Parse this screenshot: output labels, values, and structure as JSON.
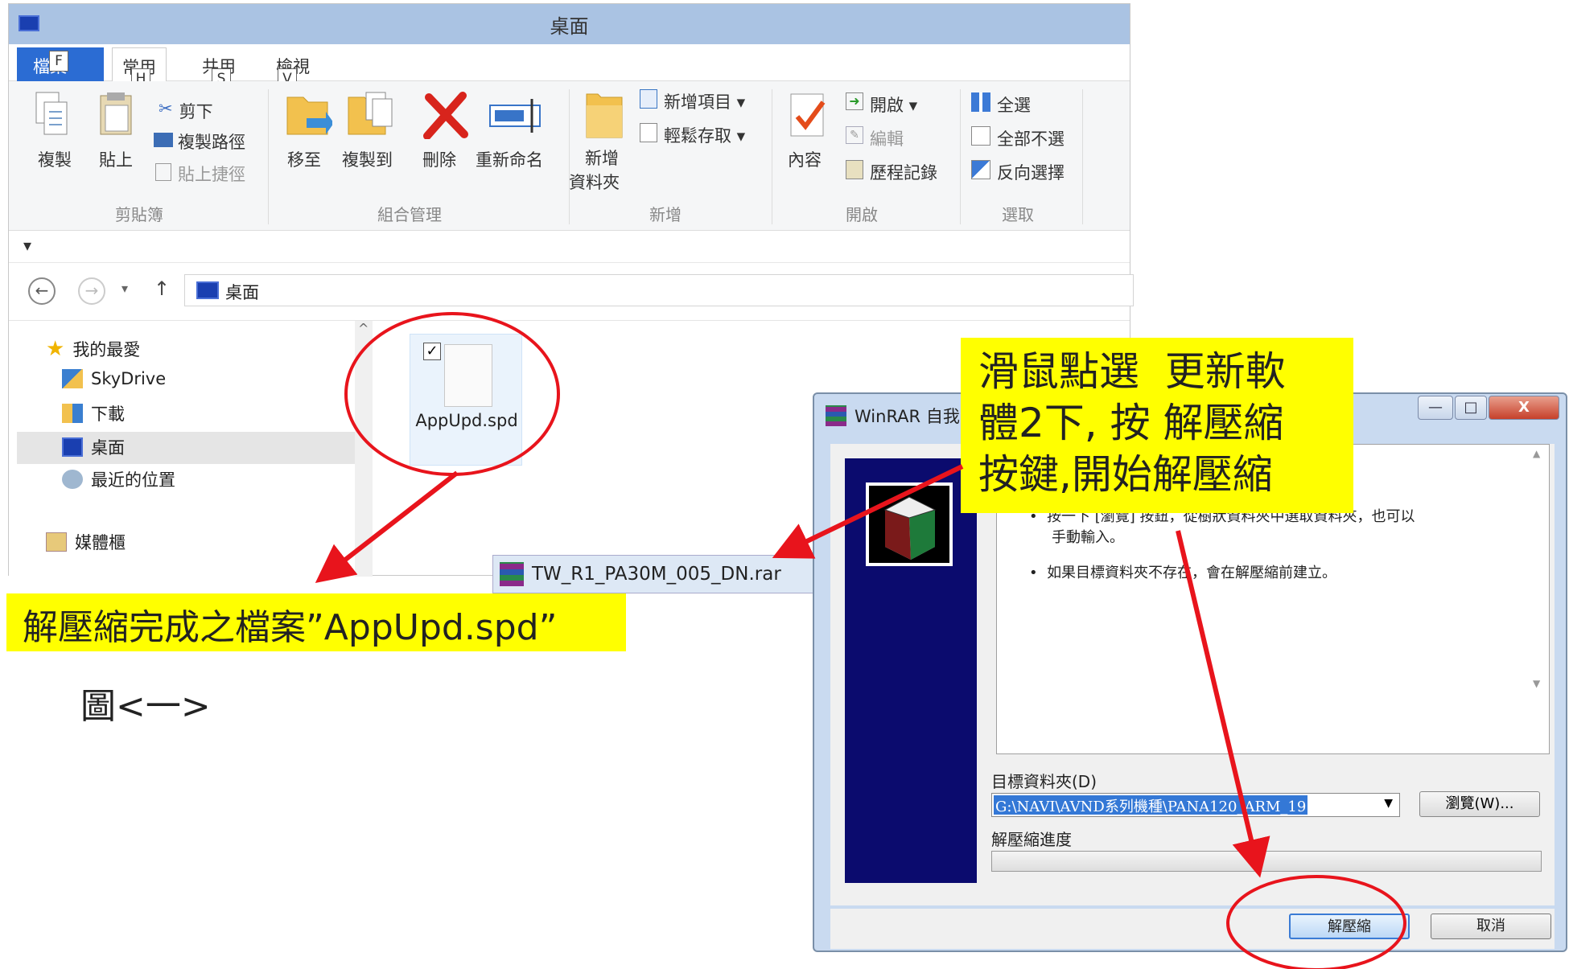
{
  "explorer": {
    "title": "桌面",
    "tabs": {
      "file": "檔案",
      "home": "常用",
      "share": "共用",
      "view": "檢視"
    },
    "keytips": {
      "file": "F",
      "home": "H",
      "share": "S",
      "view": "V"
    },
    "clipboard": {
      "copy": "複製",
      "paste": "貼上",
      "cut": "剪下",
      "copy_path": "複製路徑",
      "paste_shortcut": "貼上捷徑",
      "group": "剪貼簿"
    },
    "organize": {
      "move_to": "移至",
      "copy_to": "複製到",
      "delete": "刪除",
      "rename": "重新命名",
      "group": "組合管理"
    },
    "new": {
      "new_folder_1": "新增",
      "new_folder_2": "資料夾",
      "new_item": "新增項目 ▾",
      "easy_access": "輕鬆存取 ▾",
      "group": "新增"
    },
    "open": {
      "properties": "內容",
      "open": "開啟 ▾",
      "edit": "編輯",
      "history": "歷程記錄",
      "group": "開啟"
    },
    "select": {
      "select_all": "全選",
      "select_none": "全部不選",
      "invert": "反向選擇",
      "group": "選取"
    },
    "qat_glyph": "▾",
    "nav": {
      "back": "←",
      "forward": "→",
      "dropdown": "▾",
      "up": "↑"
    },
    "address": "桌面",
    "navpane": {
      "favorites": "我的最愛",
      "skydrive": "SkyDrive",
      "downloads": "下載",
      "desktop": "桌面",
      "recent": "最近的位置",
      "libraries": "媒體櫃"
    },
    "file": {
      "name": "AppUpd.spd",
      "check": "✓"
    }
  },
  "rar_tooltip": "TW_R1_PA30M_005_DN.rar",
  "caption_left": "解壓縮完成之檔案”AppUpd.spd”",
  "figure_label": "圖<一>",
  "caption_right": [
    "滑鼠點選  更新軟",
    "體2下, 按 解壓縮",
    "按鍵,開始解壓縮"
  ],
  "winrar": {
    "title": "WinRAR 自我",
    "bullets": [
      "按一下 [瀏覽] 按鈕，從樹狀資料夾中選取資料夾，也可以",
      "手動輸入。",
      "如果目標資料夾不存在，會在解壓縮前建立。"
    ],
    "dest_label": "目標資料夾(D)",
    "dest_value": "G:\\NAVI\\AVND系列機種\\PANA120_ARM_19",
    "browse": "瀏覽(W)...",
    "progress_label": "解壓縮進度",
    "extract": "解壓縮",
    "cancel": "取消",
    "controls": {
      "minimize": "—",
      "maximize": "□",
      "close": "X"
    }
  },
  "colors": {
    "annotation_red": "#e8141c",
    "caption_yellow": "#ffff00",
    "file_tab_blue": "#2b6cd3"
  }
}
